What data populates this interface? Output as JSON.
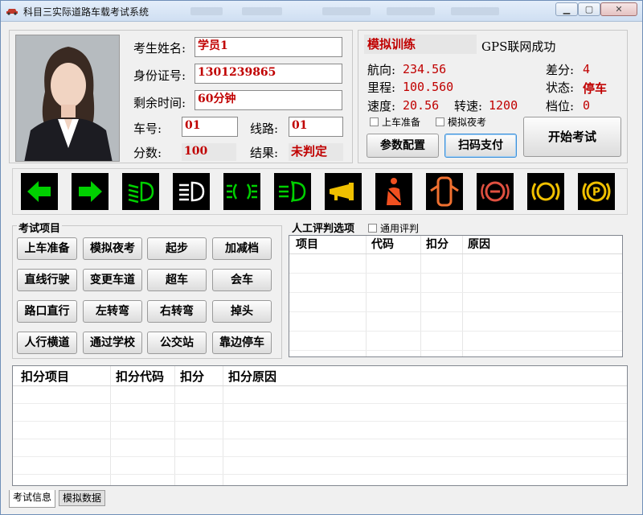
{
  "window": {
    "title": "科目三实际道路车载考试系统"
  },
  "student": {
    "name_label": "考生姓名:",
    "name": "学员1",
    "id_label": "身份证号:",
    "id": "1301239865",
    "time_label": "剩余时间:",
    "time": "60分钟",
    "car_label": "车号:",
    "car": "01",
    "route_label": "线路:",
    "route": "01",
    "score_label": "分数:",
    "score": "100",
    "result_label": "结果:",
    "result": "未判定"
  },
  "status": {
    "mode": "模拟训练",
    "gps": "GPS联网成功",
    "heading_label": "航向:",
    "heading": "234.56",
    "diff_label": "差分:",
    "diff": "4",
    "mileage_label": "里程:",
    "mileage": "100.560",
    "state_label": "状态:",
    "state": "停车",
    "speed_label": "速度:",
    "speed": "20.56",
    "rpm_label": "转速:",
    "rpm": "1200",
    "gear_label": "档位:",
    "gear": "0",
    "chk_board": "上车准备",
    "chk_night": "模拟夜考",
    "btn_config": "参数配置",
    "btn_pay": "扫码支付",
    "btn_start": "开始考试"
  },
  "indicators": [
    "left-turn-signal-icon",
    "right-turn-signal-icon",
    "low-beam-icon",
    "high-beam-icon",
    "position-light-icon",
    "fog-light-icon",
    "horn-icon",
    "seatbelt-icon",
    "door-open-icon",
    "brake-warning-icon",
    "brake-system-icon",
    "parking-brake-icon"
  ],
  "colors": {
    "accent_red": "#c00000",
    "indicator_green": "#00d000",
    "indicator_yellow": "#f0c000",
    "indicator_red": "#e05020"
  },
  "exam": {
    "label": "考试项目",
    "buttons": [
      "上车准备",
      "模拟夜考",
      "起步",
      "加减档",
      "直线行驶",
      "变更车道",
      "超车",
      "会车",
      "路口直行",
      "左转弯",
      "右转弯",
      "掉头",
      "人行横道",
      "通过学校",
      "公交站",
      "靠边停车"
    ]
  },
  "manual": {
    "label": "人工评判选项",
    "chk_general": "通用评判",
    "columns": [
      "项目",
      "代码",
      "扣分",
      "原因"
    ]
  },
  "deductions": {
    "columns": [
      "扣分项目",
      "扣分代码",
      "扣分",
      "扣分原因"
    ]
  },
  "tabs": [
    "考试信息",
    "模拟数据"
  ]
}
